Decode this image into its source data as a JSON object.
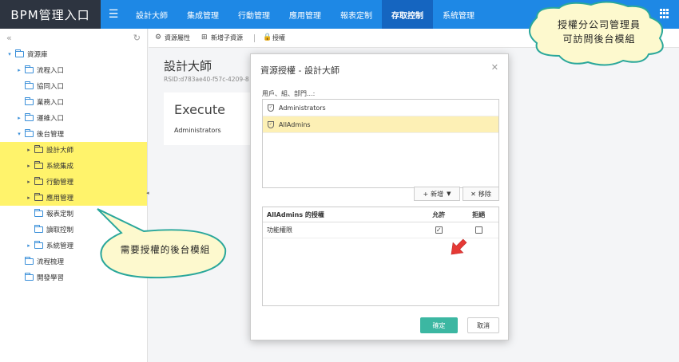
{
  "brand": {
    "title": "BPM管理入口"
  },
  "nav": {
    "items": [
      {
        "label": "設計大師",
        "active": false
      },
      {
        "label": "集成管理",
        "active": false
      },
      {
        "label": "行動管理",
        "active": false
      },
      {
        "label": "應用管理",
        "active": false
      },
      {
        "label": "報表定制",
        "active": false
      },
      {
        "label": "存取控制",
        "active": true
      },
      {
        "label": "系統管理",
        "active": false
      }
    ]
  },
  "sidebar": {
    "tree": [
      {
        "label": "資源庫",
        "level": 0,
        "caret": "▾",
        "folder": true,
        "hl": false
      },
      {
        "label": "流程入口",
        "level": 1,
        "caret": "▸",
        "folder": true,
        "hl": false
      },
      {
        "label": "協同入口",
        "level": 1,
        "caret": "",
        "folder": true,
        "hl": false
      },
      {
        "label": "業務入口",
        "level": 1,
        "caret": "",
        "folder": true,
        "hl": false
      },
      {
        "label": "運維入口",
        "level": 1,
        "caret": "▸",
        "folder": true,
        "hl": false
      },
      {
        "label": "後台管理",
        "level": 1,
        "caret": "▾",
        "folder": true,
        "hl": false
      },
      {
        "label": "設計大師",
        "level": 2,
        "caret": "▸",
        "folder": true,
        "hl": true
      },
      {
        "label": "系統集成",
        "level": 2,
        "caret": "▸",
        "folder": true,
        "hl": true
      },
      {
        "label": "行動管理",
        "level": 2,
        "caret": "▸",
        "folder": true,
        "hl": true
      },
      {
        "label": "應用管理",
        "level": 2,
        "caret": "▸",
        "folder": true,
        "hl": true
      },
      {
        "label": "報表定制",
        "level": 2,
        "caret": "",
        "folder": true,
        "hl": false
      },
      {
        "label": "讀取控制",
        "level": 2,
        "caret": "",
        "folder": true,
        "hl": false
      },
      {
        "label": "系統管理",
        "level": 2,
        "caret": "▸",
        "folder": true,
        "hl": false
      },
      {
        "label": "流程梳理",
        "level": 1,
        "caret": "",
        "folder": true,
        "hl": false
      },
      {
        "label": "開發學習",
        "level": 1,
        "caret": "",
        "folder": true,
        "hl": false
      }
    ]
  },
  "toolbar": {
    "properties_label": "資源屬性",
    "new_child_label": "新增子資源",
    "authorize_label": "授權"
  },
  "page": {
    "title": "設計大師",
    "rsid": "RSID:d783ae40-f57c-4209-8",
    "exec_title": "Execute",
    "exec_principal": "Administrators"
  },
  "modal": {
    "title": "資源授權 - 設計大師",
    "principals_label": "用戶、組、部門...:",
    "principals": [
      {
        "name": "Administrators",
        "selected": false
      },
      {
        "name": "AllAdmins",
        "selected": true
      }
    ],
    "add_label": "新增",
    "remove_label": "移除",
    "perm_header_name": "AllAdmins 的授權",
    "perm_header_allow": "允許",
    "perm_header_deny": "拒絕",
    "permissions": [
      {
        "name": "功能權限",
        "allow": true,
        "deny": false
      }
    ],
    "ok_label": "確定",
    "cancel_label": "取消"
  },
  "callouts": {
    "top_line1": "授權分公司管理員",
    "top_line2": "可訪問後台模組",
    "bottom": "需要授權的後台模組"
  },
  "colors": {
    "nav_bg": "#1e88e5",
    "nav_active": "#1565c0",
    "brand_bg": "#2d3440",
    "highlight": "#fff36b",
    "selected_row": "#fdf0b5",
    "ok_button": "#3cb7a2",
    "callout_fill": "#fdf9ce",
    "callout_stroke": "#2aa79b",
    "arrow": "#e53935"
  }
}
